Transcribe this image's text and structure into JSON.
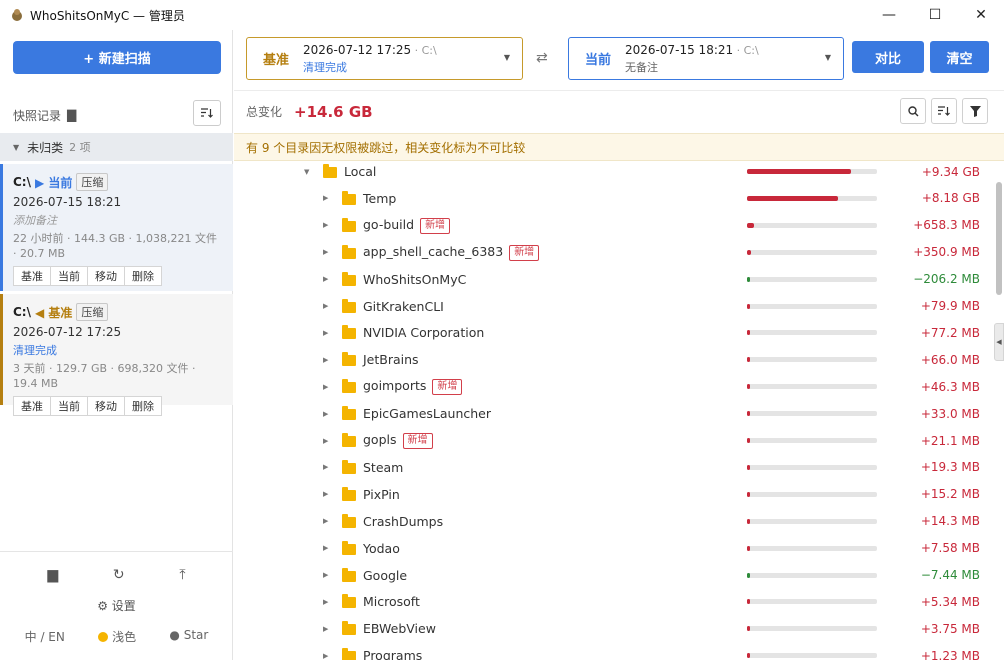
{
  "window": {
    "title": "WhoShitsOnMyC — 管理员",
    "minimize": "—",
    "maximize": "☐",
    "close": "✕"
  },
  "sidebar": {
    "new_scan": "+ 新建扫描",
    "snapshots_title": "快照记录",
    "group": {
      "name": "未归类",
      "count": "2 项"
    },
    "snapshots": [
      {
        "drive": "C:\\",
        "role_label": "▶ 当前",
        "badge": "压缩",
        "date": "2026-07-15 18:21",
        "note": "添加备注",
        "meta": "22 小时前 · 144.3 GB · 1,038,221 文件 · 20.7 MB",
        "actions": [
          "基准",
          "当前",
          "移动",
          "删除"
        ]
      },
      {
        "drive": "C:\\",
        "role_label": "◀ 基准",
        "badge": "压缩",
        "date": "2026-07-12 17:25",
        "note": "清理完成",
        "meta": "3 天前 · 129.7 GB · 698,320 文件 · 19.4 MB",
        "actions": [
          "基准",
          "当前",
          "移动",
          "删除"
        ]
      }
    ],
    "settings": "设置",
    "lang": "中 / EN",
    "theme": "浅色",
    "star": "Star"
  },
  "compare": {
    "base": {
      "label": "基准",
      "date": "2026-07-12 17:25",
      "drive": " · C:\\",
      "note": "清理完成"
    },
    "current": {
      "label": "当前",
      "date": "2026-07-15 18:21",
      "drive": " · C:\\",
      "note": "无备注"
    },
    "compare_btn": "对比",
    "clear_btn": "清空"
  },
  "summary": {
    "label": "总变化",
    "value": "+14.6 GB"
  },
  "warning": "有 9 个目录因无权限被跳过，相关变化标为不可比较",
  "colors": {
    "accent": "#3a79e0",
    "base": "#b57f10",
    "increase": "#c8283a",
    "decrease": "#2e8b3a",
    "folder": "#f4b400"
  },
  "tree": [
    {
      "name": "Local",
      "delta": "+9.34 GB",
      "sign": "pos",
      "fill": 0.8,
      "level": 0,
      "expanded": true,
      "new": false
    },
    {
      "name": "Temp",
      "delta": "+8.18 GB",
      "sign": "pos",
      "fill": 0.7,
      "level": 1,
      "new": false
    },
    {
      "name": "go-build",
      "delta": "+658.3 MB",
      "sign": "pos",
      "fill": 0.055,
      "level": 1,
      "new": true
    },
    {
      "name": "app_shell_cache_6383",
      "delta": "+350.9 MB",
      "sign": "pos",
      "fill": 0.03,
      "level": 1,
      "new": true
    },
    {
      "name": "WhoShitsOnMyC",
      "delta": "−206.2 MB",
      "sign": "neg",
      "fill": 0.02,
      "level": 1,
      "new": false
    },
    {
      "name": "GitKrakenCLI",
      "delta": "+79.9 MB",
      "sign": "pos",
      "fill": 0.012,
      "level": 1,
      "new": false
    },
    {
      "name": "NVIDIA Corporation",
      "delta": "+77.2 MB",
      "sign": "pos",
      "fill": 0.012,
      "level": 1,
      "new": false
    },
    {
      "name": "JetBrains",
      "delta": "+66.0 MB",
      "sign": "pos",
      "fill": 0.011,
      "level": 1,
      "new": false
    },
    {
      "name": "goimports",
      "delta": "+46.3 MB",
      "sign": "pos",
      "fill": 0.01,
      "level": 1,
      "new": true
    },
    {
      "name": "EpicGamesLauncher",
      "delta": "+33.0 MB",
      "sign": "pos",
      "fill": 0.01,
      "level": 1,
      "new": false
    },
    {
      "name": "gopls",
      "delta": "+21.1 MB",
      "sign": "pos",
      "fill": 0.01,
      "level": 1,
      "new": true
    },
    {
      "name": "Steam",
      "delta": "+19.3 MB",
      "sign": "pos",
      "fill": 0.01,
      "level": 1,
      "new": false
    },
    {
      "name": "PixPin",
      "delta": "+15.2 MB",
      "sign": "pos",
      "fill": 0.01,
      "level": 1,
      "new": false
    },
    {
      "name": "CrashDumps",
      "delta": "+14.3 MB",
      "sign": "pos",
      "fill": 0.01,
      "level": 1,
      "new": false
    },
    {
      "name": "Yodao",
      "delta": "+7.58 MB",
      "sign": "pos",
      "fill": 0.01,
      "level": 1,
      "new": false
    },
    {
      "name": "Google",
      "delta": "−7.44 MB",
      "sign": "neg",
      "fill": 0.01,
      "level": 1,
      "new": false
    },
    {
      "name": "Microsoft",
      "delta": "+5.34 MB",
      "sign": "pos",
      "fill": 0.01,
      "level": 1,
      "new": false
    },
    {
      "name": "EBWebView",
      "delta": "+3.75 MB",
      "sign": "pos",
      "fill": 0.01,
      "level": 1,
      "new": false
    },
    {
      "name": "Programs",
      "delta": "+1.23 MB",
      "sign": "pos",
      "fill": 0.01,
      "level": 1,
      "new": false
    }
  ],
  "new_tag_label": "新增"
}
